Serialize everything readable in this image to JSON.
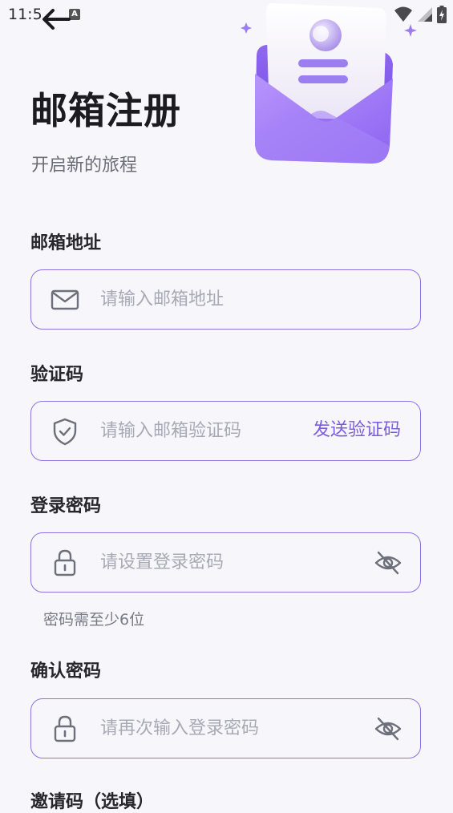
{
  "status_bar": {
    "time": "11:5",
    "notification_glyph": "A",
    "icons": [
      "wifi-icon",
      "signal-icon",
      "battery-charging-icon"
    ]
  },
  "header": {
    "back_icon": "arrow-left-icon",
    "title": "邮箱注册",
    "subtitle": "开启新的旅程",
    "illustration": "envelope-letter-illustration"
  },
  "form": {
    "email": {
      "label": "邮箱地址",
      "placeholder": "请输入邮箱地址",
      "value": "",
      "icon": "mail-icon"
    },
    "code": {
      "label": "验证码",
      "placeholder": "请输入邮箱验证码",
      "value": "",
      "icon": "shield-check-icon",
      "send_label": "发送验证码"
    },
    "password": {
      "label": "登录密码",
      "placeholder": "请设置登录密码",
      "value": "",
      "icon": "lock-icon",
      "toggle_icon": "eye-off-icon",
      "hint": "密码需至少6位"
    },
    "confirm": {
      "label": "确认密码",
      "placeholder": "请再次输入登录密码",
      "value": "",
      "icon": "lock-icon",
      "toggle_icon": "eye-off-icon"
    },
    "invite": {
      "label": "邀请码（选填）"
    }
  },
  "colors": {
    "background": "#f6f6fb",
    "accent": "#7b5be0",
    "field_border": "#8e71e4",
    "placeholder": "#a9a9b6",
    "icon": "#6f6f7c"
  }
}
